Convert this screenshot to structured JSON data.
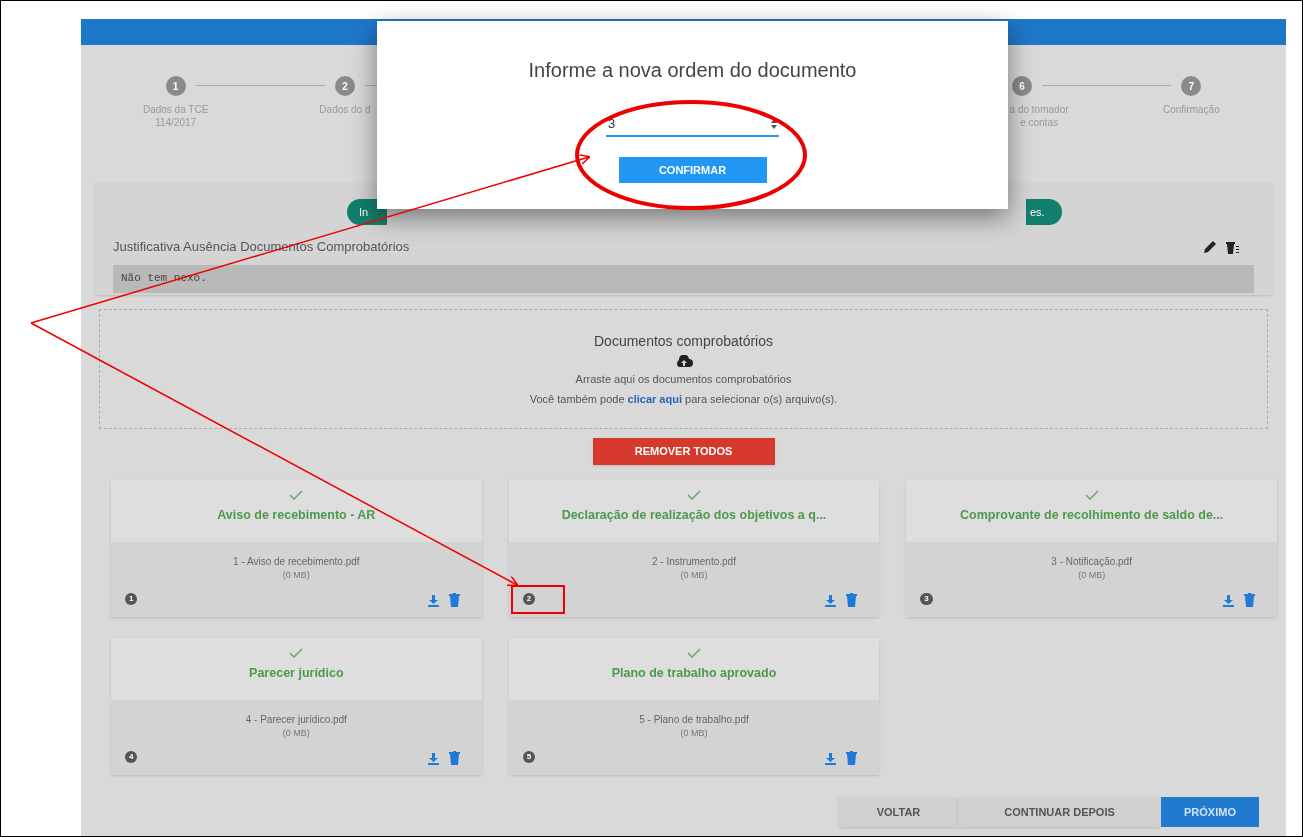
{
  "stepper": {
    "steps": [
      {
        "number": "1",
        "label": [
          "Dados da TCE",
          "114/2017"
        ]
      },
      {
        "number": "2",
        "label": [
          "Dados do d"
        ]
      },
      {
        "number": "6",
        "label": [
          "a do tomador",
          "e contas"
        ]
      },
      {
        "number": "7",
        "label": [
          "Confirmação"
        ]
      }
    ]
  },
  "notice": {
    "left_fragment": "In",
    "right_fragment": "es."
  },
  "justification": {
    "label": "Justificativa Ausência Documentos Comprobatórios",
    "text": "Não tem nexo."
  },
  "dropzone": {
    "title": "Documentos comprobatórios",
    "hint": "Arraste aqui os documentos comprobatórios",
    "link_before": "Você também pode",
    "link": "clicar aqui",
    "link_after": "para selecionar o(s) arquivo(s)."
  },
  "remove_all": "REMOVER TODOS",
  "documents": [
    {
      "title": "Aviso de recebimento - AR",
      "file": "1 - Aviso de recebimento.pdf",
      "size": "(0 MB)",
      "order": "1"
    },
    {
      "title": "Declaração de realização dos objetivos a q...",
      "file": "2 - Instrumento.pdf",
      "size": "(0 MB)",
      "order": "2"
    },
    {
      "title": "Comprovante de recolhimento de saldo de...",
      "file": "3 - Notificação.pdf",
      "size": "(0 MB)",
      "order": "3"
    },
    {
      "title": "Parecer jurídico",
      "file": "4 - Parecer jurídico.pdf",
      "size": "(0 MB)",
      "order": "4"
    },
    {
      "title": "Plano de trabalho aprovado",
      "file": "5 - Plano de trabalho.pdf",
      "size": "(0 MB)",
      "order": "5"
    }
  ],
  "footer_buttons": [
    {
      "label": "VOLTAR",
      "kind": "plain"
    },
    {
      "label": "CONTINUAR DEPOIS",
      "kind": "plain"
    },
    {
      "label": "PRÓXIMO",
      "kind": "primary"
    }
  ],
  "dialog": {
    "title": "Informe a nova ordem do documento",
    "value": "3",
    "button": "CONFIRMAR"
  }
}
